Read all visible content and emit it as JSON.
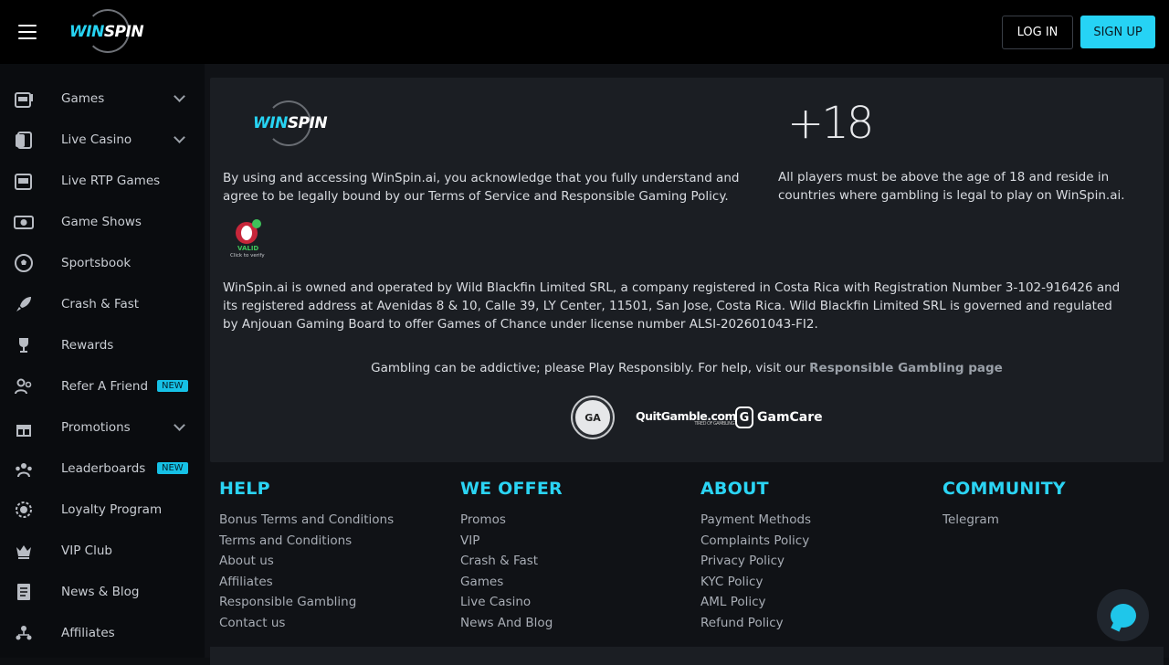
{
  "header": {
    "logo_win": "WIN",
    "logo_spin": "SPIN",
    "login_label": "LOG IN",
    "signup_label": "SIGN UP"
  },
  "sidebar": {
    "items": [
      {
        "label": "Games",
        "icon": "slot-machine-icon",
        "expandable": true
      },
      {
        "label": "Live Casino",
        "icon": "cards-icon",
        "expandable": true
      },
      {
        "label": "Live RTP Games",
        "icon": "slot-machine-icon",
        "expandable": false
      },
      {
        "label": "Game Shows",
        "icon": "tv-icon",
        "expandable": false
      },
      {
        "label": "Sportsbook",
        "icon": "soccer-ball-icon",
        "expandable": false
      },
      {
        "label": "Crash & Fast",
        "icon": "rocket-icon",
        "expandable": false
      },
      {
        "label": "Rewards",
        "icon": "trophy-icon",
        "expandable": false
      },
      {
        "label": "Refer A Friend",
        "icon": "users-icon",
        "expandable": false,
        "badge": "NEW"
      },
      {
        "label": "Promotions",
        "icon": "gift-icon",
        "expandable": true
      },
      {
        "label": "Leaderboards",
        "icon": "leaderboard-icon",
        "expandable": false,
        "badge": "NEW"
      },
      {
        "label": "Loyalty Program",
        "icon": "loyalty-icon",
        "expandable": false
      },
      {
        "label": "VIP Club",
        "icon": "crown-icon",
        "expandable": false
      },
      {
        "label": "News & Blog",
        "icon": "document-icon",
        "expandable": false
      },
      {
        "label": "Affiliates",
        "icon": "network-icon",
        "expandable": false
      }
    ]
  },
  "info": {
    "plus18": "+18",
    "terms_text": "By using and accessing WinSpin.ai, you acknowledge that you fully understand and agree to be legally bound by our Terms of Service and Responsible Gaming Policy.",
    "age_text": "All players must be above the age of 18 and reside in countries where gambling is legal to play on WinSpin.ai.",
    "valid_label": "VALID",
    "verify_label": "Click to verify",
    "license_text": "WinSpin.ai is owned and operated by Wild Blackfin Limited SRL, a company registered in Costa Rica with Registration Number 3-102-916426 and its registered address at Avenidas 8 & 10, Calle 39, LY Center, 11501, San Jose, Costa Rica. Wild Blackfin Limited SRL is governed and regulated by Anjouan Gaming Board to offer Games of Chance under license number ALSI-202601043-FI2.",
    "gamble_text": "Gambling can be addictive; please Play Responsibly. For help, visit our ",
    "gamble_link": "Responsible Gambling page",
    "partner_gca": "GA",
    "partner_quit": "QuitGamble.com",
    "partner_quit_sub": "TIRED OF GAMBLING?",
    "partner_gamcare": "GamCare"
  },
  "footer": {
    "help": {
      "title": "HELP",
      "links": [
        "Bonus Terms and Conditions",
        "Terms and Conditions",
        "About us",
        "Affiliates",
        "Responsible Gambling",
        "Contact us"
      ]
    },
    "offer": {
      "title": "WE OFFER",
      "links": [
        "Promos",
        "VIP",
        "Crash & Fast",
        "Games",
        "Live Casino",
        "News And Blog"
      ]
    },
    "about": {
      "title": "ABOUT",
      "links": [
        "Payment Methods",
        "Complaints Policy",
        "Privacy Policy",
        "KYC Policy",
        "AML Policy",
        "Refund Policy"
      ]
    },
    "community": {
      "title": "COMMUNITY",
      "links": [
        "Telegram"
      ]
    }
  },
  "colors": {
    "accent": "#26d3f5",
    "background": "#101216",
    "card": "#1b1e23"
  }
}
